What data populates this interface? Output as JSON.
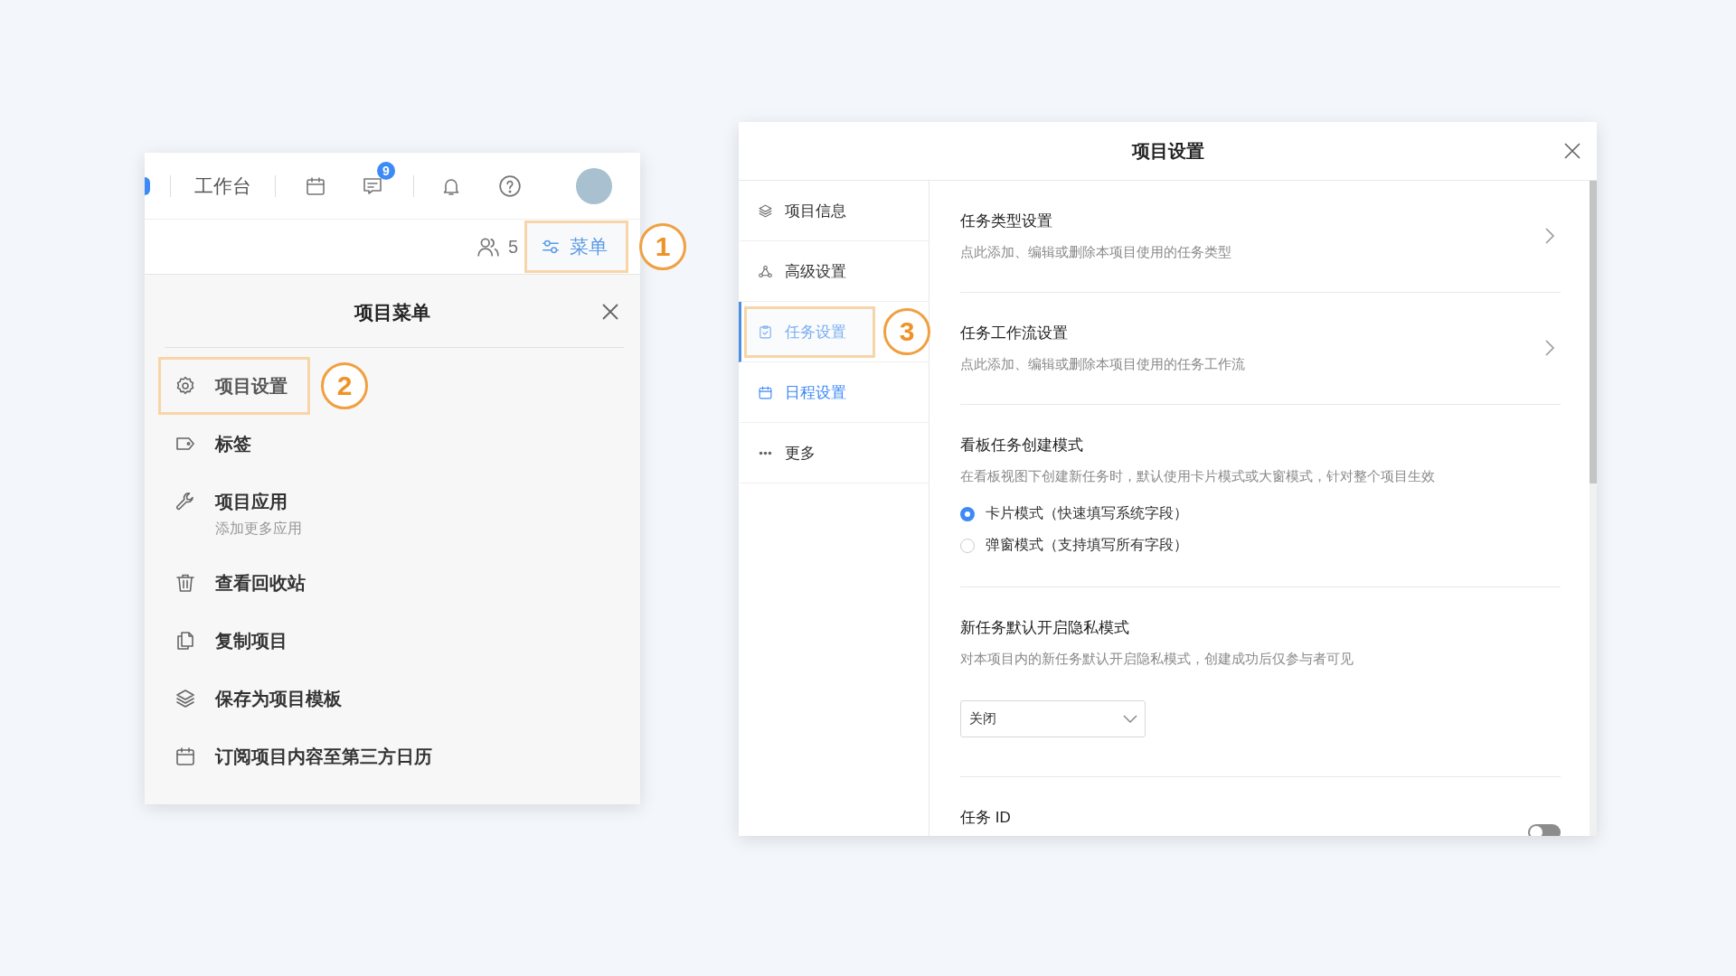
{
  "project_menu_card": {
    "nav": {
      "label": "工作台",
      "message_badge": "9"
    },
    "members_count": "5",
    "menu_button": {
      "label": "菜单",
      "highlighted": true,
      "callout": "1"
    },
    "menu": {
      "title": "项目菜单",
      "items": [
        {
          "label": "项目设置",
          "highlighted": true,
          "callout": "2"
        },
        {
          "label": "标签",
          "highlighted": false
        },
        {
          "label": "项目应用",
          "subtitle": "添加更多应用",
          "highlighted": false
        },
        {
          "label": "查看回收站",
          "highlighted": false
        },
        {
          "label": "复制项目",
          "highlighted": false
        },
        {
          "label": "保存为项目模板",
          "highlighted": false
        },
        {
          "label": "订阅项目内容至第三方日历",
          "highlighted": false
        }
      ]
    }
  },
  "settings_dialog": {
    "title": "项目设置",
    "sidebar": [
      {
        "label": "项目信息",
        "selected": false,
        "hovered": false,
        "highlighted": false
      },
      {
        "label": "高级设置",
        "selected": false,
        "hovered": false,
        "highlighted": false
      },
      {
        "label": "任务设置",
        "selected": true,
        "hovered": false,
        "highlighted": true,
        "callout": "3"
      },
      {
        "label": "日程设置",
        "selected": false,
        "hovered": true,
        "highlighted": false
      },
      {
        "label": "更多",
        "selected": false,
        "hovered": false,
        "highlighted": false
      }
    ],
    "sections": [
      {
        "kind": "link",
        "title": "任务类型设置",
        "description": "点此添加、编辑或删除本项目使用的任务类型"
      },
      {
        "kind": "link",
        "title": "任务工作流设置",
        "description": "点此添加、编辑或删除本项目使用的任务工作流"
      },
      {
        "kind": "radio",
        "title": "看板任务创建模式",
        "description": "在看板视图下创建新任务时，默认使用卡片模式或大窗模式，针对整个项目生效",
        "options": [
          {
            "label": "卡片模式（快速填写系统字段）",
            "selected": true
          },
          {
            "label": "弹窗模式（支持填写所有字段）",
            "selected": false
          }
        ]
      },
      {
        "kind": "select",
        "title": "新任务默认开启隐私模式",
        "description": "对本项目内的新任务默认开启隐私模式，创建成功后仅参与者可见",
        "value": "关闭"
      },
      {
        "kind": "toggle",
        "title": "任务 ID",
        "on": false
      }
    ]
  }
}
